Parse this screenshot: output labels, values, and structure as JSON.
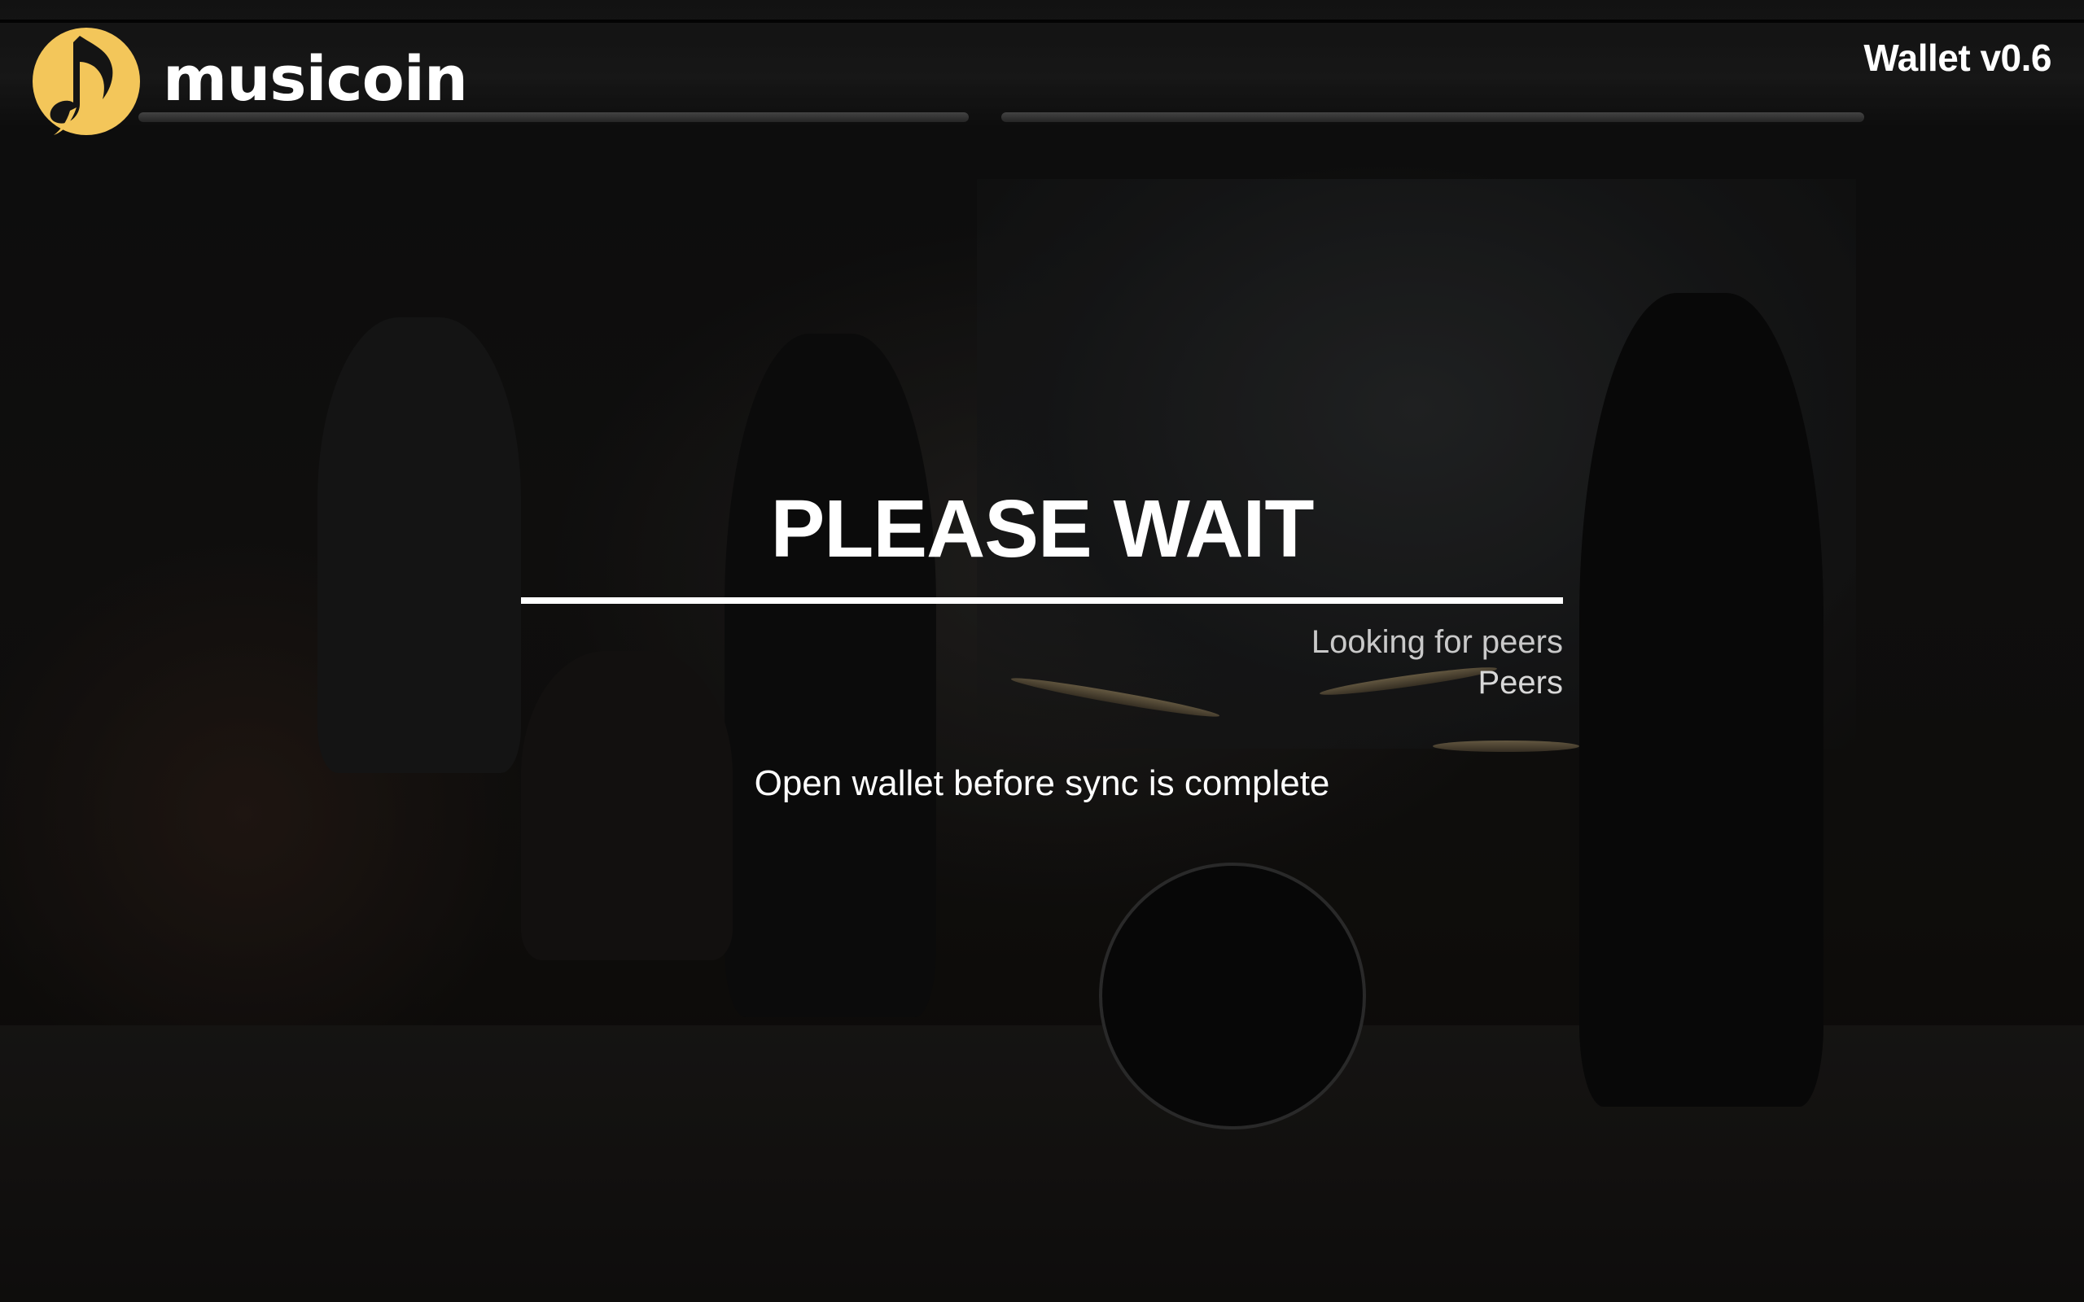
{
  "header": {
    "brand": "musicoin",
    "version": "Wallet v0.6",
    "logo_icon": "musicoin-note-logo-icon"
  },
  "sync": {
    "title": "PLEASE WAIT",
    "progress": 1.0,
    "status": "Looking for peers",
    "peers_label": "Peers",
    "open_wallet_label": "Open wallet before sync is complete"
  },
  "colors": {
    "brand_accent": "#F3C65A",
    "text": "#FFFFFF",
    "background": "#121212"
  }
}
